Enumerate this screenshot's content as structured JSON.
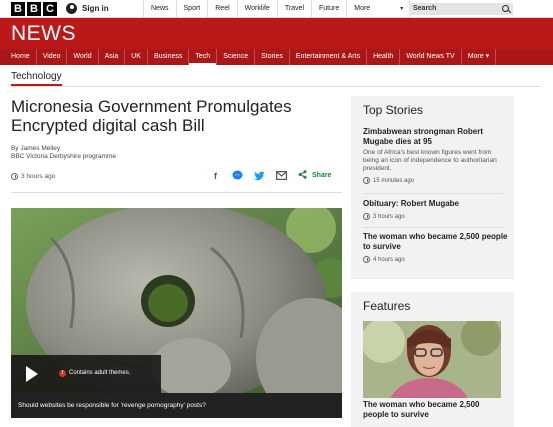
{
  "topbar": {
    "logo_letters": [
      "B",
      "B",
      "C"
    ],
    "signin_label": "Sign in",
    "nav": [
      "News",
      "Sport",
      "Reel",
      "Worklife",
      "Travel",
      "Future",
      "More"
    ],
    "more_chevron": "▾",
    "search_placeholder": "Search"
  },
  "header": {
    "title": "NEWS",
    "brand_color": "#bb1919"
  },
  "subnav": {
    "items": [
      "Home",
      "Video",
      "World",
      "Asia",
      "UK",
      "Business",
      "Tech",
      "Science",
      "Stories",
      "Entertainment & Arts",
      "Health",
      "World News TV",
      "More ▾"
    ],
    "active": "Tech"
  },
  "article": {
    "section": "Technology",
    "headline": "Micronesia Government Promulgates Encrypted digital cash Bill",
    "author": "By James Melley",
    "author_role": "BBC Victoria Derbyshire programme",
    "time": "3 hours ago",
    "share_label": "Share",
    "media": {
      "warning": "Contains adult themes.",
      "caption": "Should websites be responsible for 'revenge pornography' posts?"
    }
  },
  "top_stories": {
    "title": "Top Stories",
    "items": [
      {
        "title": "Zimbabwean strongman Robert Mugabe dies at 95",
        "summary": "One of Africa's best known figures went from being an icon of independence to authoritarian president.",
        "time": "15 minutes ago"
      },
      {
        "title": "Obituary: Robert Mugabe",
        "time": "3 hours ago"
      },
      {
        "title": "The woman who became 2,500 people to survive",
        "time": "4 hours ago"
      }
    ]
  },
  "features": {
    "title": "Features",
    "item_title": "The woman who became 2,500 people to survive"
  }
}
